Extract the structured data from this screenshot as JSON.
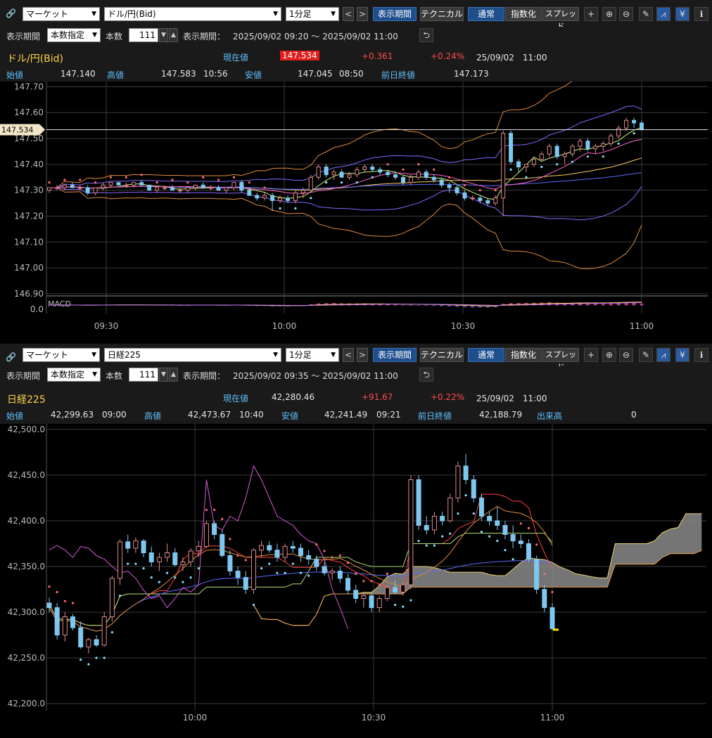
{
  "top": {
    "toolbar": {
      "market": "マーケット",
      "symbol": "ドル/円(Bid)",
      "interval": "1分足",
      "period_btn": "表示期間",
      "technical_btn": "テクニカル",
      "normal_btn": "通常",
      "index_btn": "指数化",
      "spread_btn": "スプレッド"
    },
    "period_row": {
      "label": "表示期間",
      "mode": "本数指定",
      "count_label": "本数",
      "count": "111",
      "range_label": "表示期間：",
      "range": "2025/09/02 09:20 ～ 2025/09/02 11:00"
    },
    "quote": {
      "name": "ドル/円(Bid)",
      "current_label": "現在値",
      "current": "147.534",
      "change": "+0.361",
      "change_pct": "+0.24%",
      "datetime": "25/09/02　11:00",
      "open_label": "始値",
      "open": "147.140",
      "high_label": "高値",
      "high": "147.583",
      "high_time": "10:56",
      "low_label": "安値",
      "low": "147.045",
      "low_time": "08:50",
      "prev_label": "前日終値",
      "prev": "147.173"
    }
  },
  "bottom": {
    "toolbar": {
      "market": "マーケット",
      "symbol": "日経225",
      "interval": "1分足",
      "period_btn": "表示期間",
      "technical_btn": "テクニカル",
      "normal_btn": "通常",
      "index_btn": "指数化",
      "spread_btn": "スプレッド"
    },
    "period_row": {
      "label": "表示期間",
      "mode": "本数指定",
      "count_label": "本数",
      "count": "111",
      "range_label": "表示期間：",
      "range": "2025/09/02 09:35 ～ 2025/09/02 11:00"
    },
    "quote": {
      "name": "日経225",
      "current_label": "現在値",
      "current": "42,280.46",
      "change": "+91.67",
      "change_pct": "+0.22%",
      "datetime": "25/09/02　11:00",
      "open_label": "始値",
      "open": "42,299.63",
      "open_time": "09:00",
      "high_label": "高値",
      "high": "42,473.67",
      "high_time": "10:40",
      "low_label": "安値",
      "low": "42,241.49",
      "low_time": "09:21",
      "prev_label": "前日終値",
      "prev": "42,188.79",
      "volume_label": "出来高",
      "volume": "0"
    }
  },
  "chart_data": [
    {
      "type": "candlestick",
      "title": "ドル/円(Bid)",
      "ylim": [
        146.9,
        147.72
      ],
      "y_ticks": [
        "147.70",
        "147.60",
        "147.50",
        "147.40",
        "147.30",
        "147.20",
        "147.10",
        "147.00",
        "146.90"
      ],
      "x_ticks": [
        "09:30",
        "10:00",
        "10:30",
        "11:00"
      ],
      "last_price_label": "147.534",
      "indicator_label": "MACD",
      "indicator_tick": "0.0",
      "candles": [
        [
          147.3,
          147.31,
          147.29,
          147.31
        ],
        [
          147.31,
          147.32,
          147.3,
          147.31
        ],
        [
          147.31,
          147.32,
          147.3,
          147.32
        ],
        [
          147.32,
          147.33,
          147.31,
          147.31
        ],
        [
          147.31,
          147.32,
          147.3,
          147.31
        ],
        [
          147.31,
          147.32,
          147.28,
          147.29
        ],
        [
          147.29,
          147.31,
          147.28,
          147.31
        ],
        [
          147.31,
          147.33,
          147.3,
          147.32
        ],
        [
          147.32,
          147.33,
          147.31,
          147.33
        ],
        [
          147.33,
          147.33,
          147.32,
          147.32
        ],
        [
          147.32,
          147.33,
          147.31,
          147.32
        ],
        [
          147.32,
          147.33,
          147.31,
          147.33
        ],
        [
          147.33,
          147.34,
          147.32,
          147.32
        ],
        [
          147.32,
          147.32,
          147.3,
          147.3
        ],
        [
          147.3,
          147.31,
          147.29,
          147.31
        ],
        [
          147.31,
          147.32,
          147.3,
          147.31
        ],
        [
          147.31,
          147.32,
          147.3,
          147.3
        ],
        [
          147.3,
          147.31,
          147.29,
          147.3
        ],
        [
          147.3,
          147.31,
          147.29,
          147.31
        ],
        [
          147.31,
          147.32,
          147.3,
          147.32
        ],
        [
          147.32,
          147.33,
          147.31,
          147.31
        ],
        [
          147.31,
          147.32,
          147.3,
          147.31
        ],
        [
          147.31,
          147.32,
          147.3,
          147.3
        ],
        [
          147.3,
          147.31,
          147.29,
          147.31
        ],
        [
          147.31,
          147.33,
          147.3,
          147.33
        ],
        [
          147.33,
          147.34,
          147.29,
          147.3
        ],
        [
          147.3,
          147.31,
          147.28,
          147.28
        ],
        [
          147.28,
          147.29,
          147.26,
          147.27
        ],
        [
          147.27,
          147.29,
          147.26,
          147.28
        ],
        [
          147.28,
          147.29,
          147.22,
          147.26
        ],
        [
          147.26,
          147.28,
          147.25,
          147.27
        ],
        [
          147.27,
          147.28,
          147.25,
          147.26
        ],
        [
          147.26,
          147.3,
          147.25,
          147.29
        ],
        [
          147.29,
          147.31,
          147.27,
          147.3
        ],
        [
          147.3,
          147.36,
          147.29,
          147.35
        ],
        [
          147.35,
          147.4,
          147.34,
          147.39
        ],
        [
          147.39,
          147.4,
          147.35,
          147.36
        ],
        [
          147.36,
          147.38,
          147.34,
          147.37
        ],
        [
          147.37,
          147.38,
          147.35,
          147.35
        ],
        [
          147.35,
          147.37,
          147.34,
          147.36
        ],
        [
          147.36,
          147.39,
          147.35,
          147.38
        ],
        [
          147.38,
          147.4,
          147.37,
          147.39
        ],
        [
          147.39,
          147.4,
          147.37,
          147.38
        ],
        [
          147.38,
          147.39,
          147.36,
          147.37
        ],
        [
          147.37,
          147.38,
          147.35,
          147.36
        ],
        [
          147.36,
          147.37,
          147.34,
          147.35
        ],
        [
          147.35,
          147.36,
          147.32,
          147.33
        ],
        [
          147.33,
          147.36,
          147.32,
          147.35
        ],
        [
          147.35,
          147.38,
          147.34,
          147.37
        ],
        [
          147.37,
          147.38,
          147.34,
          147.35
        ],
        [
          147.35,
          147.36,
          147.33,
          147.34
        ],
        [
          147.34,
          147.35,
          147.31,
          147.32
        ],
        [
          147.32,
          147.33,
          147.29,
          147.31
        ],
        [
          147.31,
          147.32,
          147.28,
          147.29
        ],
        [
          147.29,
          147.3,
          147.26,
          147.27
        ],
        [
          147.27,
          147.28,
          147.26,
          147.27
        ],
        [
          147.27,
          147.28,
          147.25,
          147.26
        ],
        [
          147.26,
          147.27,
          147.24,
          147.25
        ],
        [
          147.25,
          147.28,
          147.24,
          147.27
        ],
        [
          147.27,
          147.53,
          147.2,
          147.52
        ],
        [
          147.52,
          147.53,
          147.4,
          147.41
        ],
        [
          147.41,
          147.42,
          147.37,
          147.39
        ],
        [
          147.39,
          147.4,
          147.37,
          147.4
        ],
        [
          147.4,
          147.43,
          147.39,
          147.42
        ],
        [
          147.42,
          147.45,
          147.41,
          147.44
        ],
        [
          147.44,
          147.48,
          147.43,
          147.47
        ],
        [
          147.47,
          147.48,
          147.42,
          147.43
        ],
        [
          147.43,
          147.45,
          147.4,
          147.44
        ],
        [
          147.44,
          147.48,
          147.43,
          147.47
        ],
        [
          147.47,
          147.5,
          147.45,
          147.49
        ],
        [
          147.49,
          147.5,
          147.45,
          147.46
        ],
        [
          147.46,
          147.48,
          147.44,
          147.47
        ],
        [
          147.47,
          147.49,
          147.45,
          147.48
        ],
        [
          147.48,
          147.52,
          147.47,
          147.51
        ],
        [
          147.51,
          147.55,
          147.5,
          147.54
        ],
        [
          147.54,
          147.58,
          147.53,
          147.57
        ],
        [
          147.57,
          147.58,
          147.54,
          147.56
        ],
        [
          147.56,
          147.57,
          147.53,
          147.534
        ]
      ]
    },
    {
      "type": "candlestick",
      "title": "日経225",
      "ylim": [
        42200,
        42500
      ],
      "y_ticks": [
        "42,500.0",
        "42,450.0",
        "42,400.0",
        "42,350.0",
        "42,300.0",
        "42,250.0",
        "42,200.0"
      ],
      "x_ticks": [
        "10:00",
        "10:30",
        "11:00"
      ],
      "candles": [
        [
          42310,
          42316,
          42300,
          42305
        ],
        [
          42305,
          42310,
          42270,
          42275
        ],
        [
          42275,
          42300,
          42268,
          42295
        ],
        [
          42295,
          42298,
          42280,
          42283
        ],
        [
          42283,
          42290,
          42260,
          42262
        ],
        [
          42262,
          42272,
          42255,
          42270
        ],
        [
          42270,
          42275,
          42262,
          42264
        ],
        [
          42264,
          42300,
          42262,
          42295
        ],
        [
          42295,
          42340,
          42290,
          42337
        ],
        [
          42337,
          42380,
          42330,
          42377
        ],
        [
          42377,
          42385,
          42365,
          42370
        ],
        [
          42370,
          42382,
          42365,
          42378
        ],
        [
          42378,
          42380,
          42360,
          42365
        ],
        [
          42365,
          42372,
          42350,
          42355
        ],
        [
          42355,
          42365,
          42345,
          42360
        ],
        [
          42360,
          42375,
          42355,
          42365
        ],
        [
          42365,
          42370,
          42350,
          42352
        ],
        [
          42352,
          42360,
          42345,
          42355
        ],
        [
          42355,
          42370,
          42350,
          42367
        ],
        [
          42367,
          42378,
          42360,
          42372
        ],
        [
          42372,
          42400,
          42370,
          42397
        ],
        [
          42397,
          42400,
          42380,
          42385
        ],
        [
          42385,
          42390,
          42360,
          42362
        ],
        [
          42362,
          42368,
          42340,
          42345
        ],
        [
          42345,
          42350,
          42330,
          42338
        ],
        [
          42338,
          42345,
          42320,
          42325
        ],
        [
          42325,
          42370,
          42320,
          42368
        ],
        [
          42368,
          42378,
          42360,
          42373
        ],
        [
          42373,
          42378,
          42365,
          42368
        ],
        [
          42368,
          42375,
          42355,
          42360
        ],
        [
          42360,
          42375,
          42355,
          42372
        ],
        [
          42372,
          42378,
          42365,
          42370
        ],
        [
          42370,
          42375,
          42355,
          42362
        ],
        [
          42362,
          42368,
          42352,
          42358
        ],
        [
          42358,
          42362,
          42345,
          42350
        ],
        [
          42350,
          42355,
          42340,
          42343
        ],
        [
          42343,
          42348,
          42335,
          42345
        ],
        [
          42345,
          42350,
          42332,
          42337
        ],
        [
          42337,
          42342,
          42320,
          42324
        ],
        [
          42324,
          42330,
          42310,
          42315
        ],
        [
          42315,
          42322,
          42305,
          42318
        ],
        [
          42318,
          42322,
          42300,
          42305
        ],
        [
          42305,
          42318,
          42300,
          42315
        ],
        [
          42315,
          42330,
          42312,
          42327
        ],
        [
          42327,
          42335,
          42320,
          42322
        ],
        [
          42322,
          42332,
          42318,
          42330
        ],
        [
          42330,
          42450,
          42325,
          42445
        ],
        [
          42445,
          42450,
          42390,
          42395
        ],
        [
          42395,
          42405,
          42385,
          42390
        ],
        [
          42390,
          42410,
          42385,
          42405
        ],
        [
          42405,
          42410,
          42395,
          42400
        ],
        [
          42400,
          42430,
          42398,
          42425
        ],
        [
          42425,
          42465,
          42420,
          42460
        ],
        [
          42460,
          42473,
          42440,
          42445
        ],
        [
          42445,
          42450,
          42420,
          42425
        ],
        [
          42425,
          42430,
          42400,
          42405
        ],
        [
          42405,
          42410,
          42395,
          42400
        ],
        [
          42400,
          42415,
          42390,
          42395
        ],
        [
          42395,
          42400,
          42380,
          42385
        ],
        [
          42385,
          42395,
          42370,
          42378
        ],
        [
          42378,
          42385,
          42370,
          42375
        ],
        [
          42375,
          42380,
          42355,
          42358
        ],
        [
          42358,
          42362,
          42320,
          42325
        ],
        [
          42325,
          42330,
          42300,
          42305
        ],
        [
          42305,
          42310,
          42280,
          42282
        ]
      ],
      "last_price": 42280.46
    }
  ]
}
